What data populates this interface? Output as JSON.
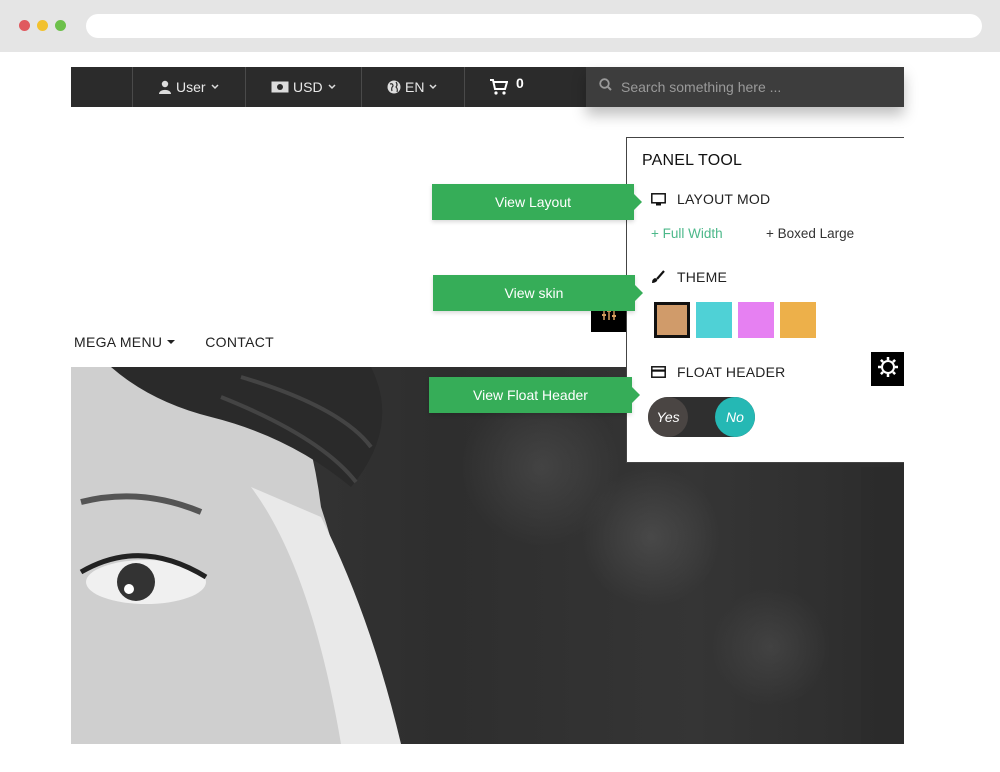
{
  "topbar": {
    "user_label": "User",
    "currency_label": "USD",
    "language_label": "EN",
    "cart_count": "0"
  },
  "search": {
    "placeholder": "Search something here ..."
  },
  "nav": {
    "items": [
      {
        "label": "MEGA MENU"
      },
      {
        "label": "CONTACT"
      }
    ]
  },
  "panel": {
    "title": "PANEL TOOL",
    "layout_heading": "LAYOUT MOD",
    "layout_options": [
      "+ Full Width",
      "+ Boxed Large"
    ],
    "theme_heading": "THEME",
    "theme_swatches": [
      "#d09b6a",
      "#4fd1d6",
      "#e680f2",
      "#edb04a"
    ],
    "float_heading": "FLOAT HEADER",
    "toggle_yes": "Yes",
    "toggle_no": "No"
  },
  "callouts": {
    "layout": "View Layout",
    "skin": "View skin",
    "float_header": "View Float Header"
  },
  "colors": {
    "accent_green": "#36ad58",
    "toggle_teal": "#25b8b4",
    "link_green": "#4cb88a"
  }
}
